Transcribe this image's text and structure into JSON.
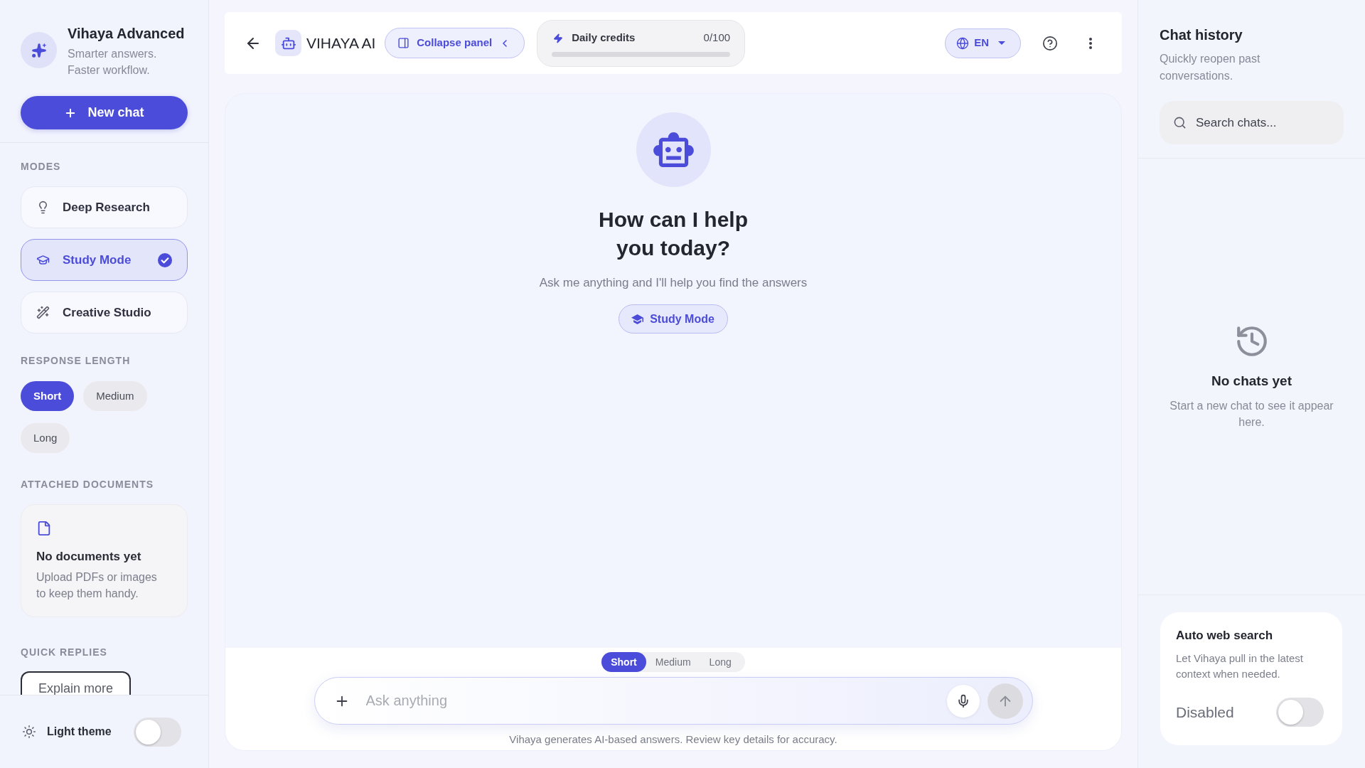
{
  "sidebar": {
    "brand": {
      "title": "Vihaya Advanced",
      "tagline": "Smarter answers. Faster workflow."
    },
    "new_chat": "New chat",
    "modes": {
      "heading": "MODES",
      "items": [
        {
          "label": "Deep Research",
          "selected": false
        },
        {
          "label": "Study Mode",
          "selected": true
        },
        {
          "label": "Creative Studio",
          "selected": false
        }
      ]
    },
    "response_length": {
      "heading": "RESPONSE LENGTH",
      "options": [
        {
          "label": "Short",
          "selected": true
        },
        {
          "label": "Medium",
          "selected": false
        },
        {
          "label": "Long",
          "selected": false
        }
      ]
    },
    "attached_documents": {
      "heading": "ATTACHED DOCUMENTS",
      "empty_title": "No documents yet",
      "empty_text": "Upload PDFs or images to keep them handy."
    },
    "quick_replies": {
      "heading": "QUICK REPLIES",
      "items": [
        "Explain more"
      ]
    },
    "theme": {
      "label": "Light theme",
      "on": false
    }
  },
  "header": {
    "title": "VIHAYA AI",
    "collapse_button": "Collapse panel",
    "credits": {
      "label": "Daily credits",
      "reading": "0/100",
      "level": 0
    },
    "language": "EN"
  },
  "chat": {
    "greeting": "How can I help you today?",
    "subtitle": "Ask me anything and I'll help you find the answers",
    "mode_badge": "Study Mode",
    "length_options": [
      {
        "label": "Short",
        "selected": true
      },
      {
        "label": "Medium",
        "selected": false
      },
      {
        "label": "Long",
        "selected": false
      }
    ],
    "input": {
      "placeholder": "Ask anything"
    },
    "disclaimer": "Vihaya generates AI-based answers. Review key details for accuracy."
  },
  "history": {
    "title": "Chat history",
    "subtitle": "Quickly reopen past conversations.",
    "search": {
      "placeholder": "Search chats..."
    },
    "empty_title": "No chats yet",
    "empty_text": "Start a new chat to see it appear here.",
    "auto_web_search": {
      "title": "Auto web search",
      "text": "Let Vihaya pull in the latest context when needed.",
      "status": "Disabled",
      "on": false
    }
  }
}
